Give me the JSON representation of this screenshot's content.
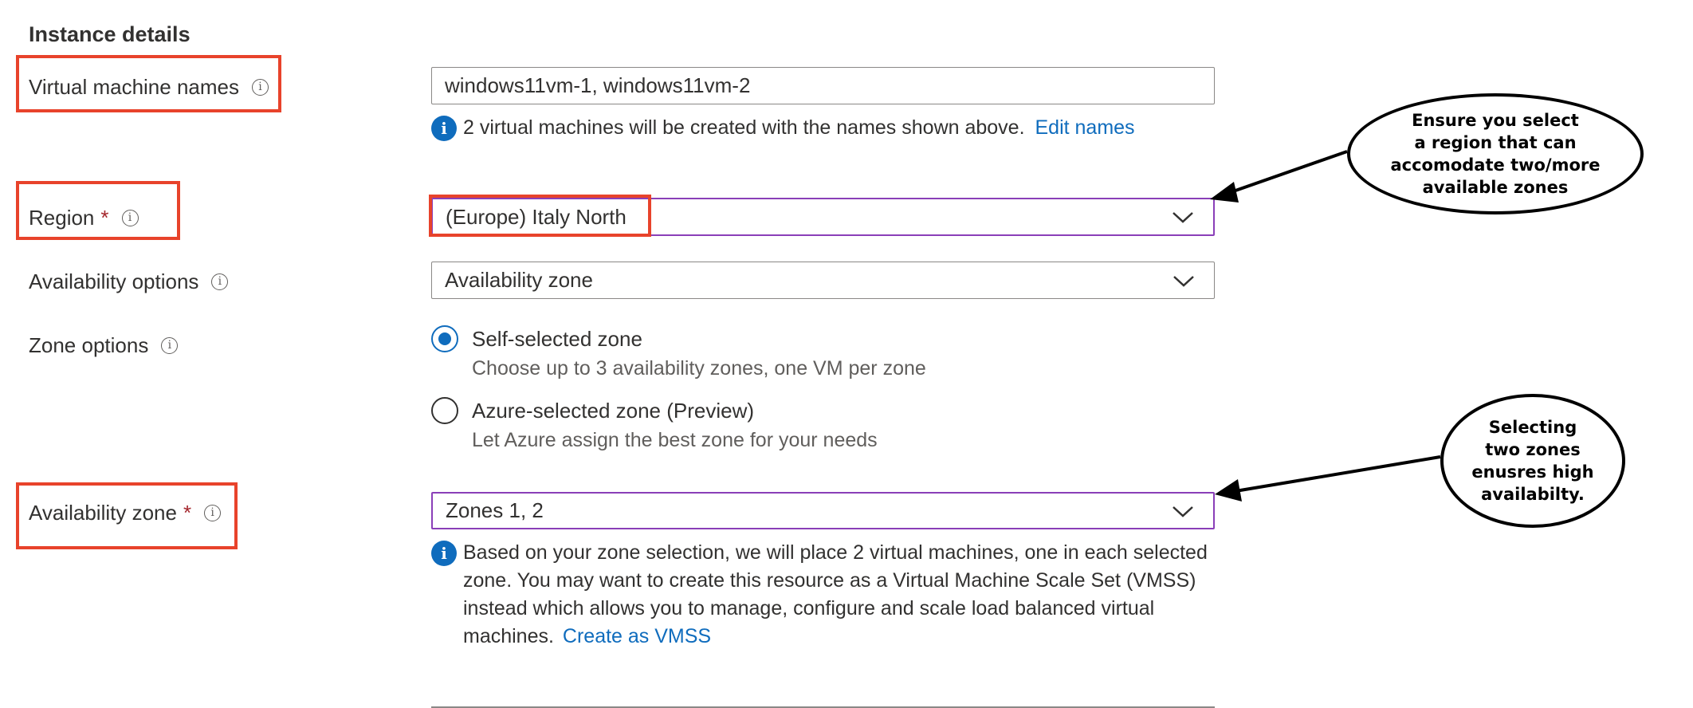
{
  "section": {
    "title": "Instance details"
  },
  "vm_names": {
    "label": "Virtual machine names",
    "info_icon": "info-icon",
    "value": "windows11vm-1, windows11vm-2",
    "message": "2 virtual machines will be created with the names shown above.",
    "edit_link": "Edit names"
  },
  "region": {
    "label": "Region",
    "required_mark": "*",
    "value": "(Europe) Italy North",
    "dropdown_icon": "chevron-down-icon"
  },
  "availability_options": {
    "label": "Availability options",
    "value": "Availability zone"
  },
  "zone_options": {
    "label": "Zone options",
    "options": [
      {
        "label": "Self-selected zone",
        "description": "Choose up to 3 availability zones, one VM per zone",
        "selected": true
      },
      {
        "label": "Azure-selected zone (Preview)",
        "description": "Let Azure assign the best zone for your needs",
        "selected": false
      }
    ]
  },
  "availability_zone": {
    "label": "Availability zone",
    "required_mark": "*",
    "value": "Zones 1, 2",
    "message": "Based on your zone selection, we will place 2 virtual machines, one in each selected zone. You may want to create this resource as a Virtual Machine Scale Set (VMSS) instead which allows you to manage, configure and scale load balanced virtual machines.",
    "vmss_link": "Create as VMSS"
  },
  "callouts": {
    "region_note": "Ensure you select\na region that can\naccomodate two/more\navailable zones",
    "zone_note": "Selecting\ntwo zones\nenusres high\navailabilty."
  },
  "colors": {
    "highlight_red": "#e8432b",
    "focus_purple": "#8a3fb8",
    "link_blue": "#0f6cbd",
    "required_red": "#a4262c"
  }
}
